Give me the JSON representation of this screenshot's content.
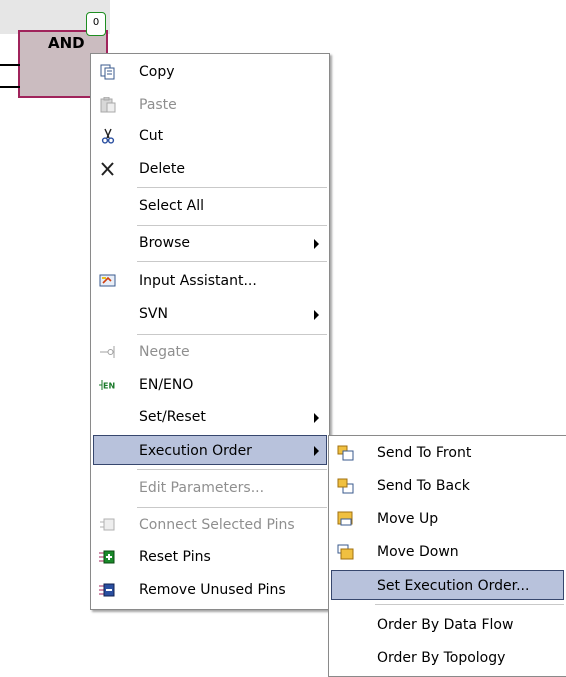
{
  "block": {
    "title": "AND",
    "order_badge": "0"
  },
  "context_menu": {
    "items": [
      {
        "label": "Copy",
        "enabled": true,
        "icon": "copy-icon"
      },
      {
        "label": "Paste",
        "enabled": false,
        "icon": "paste-icon"
      },
      {
        "label": "Cut",
        "enabled": true,
        "icon": "cut-icon"
      },
      {
        "label": "Delete",
        "enabled": true,
        "icon": "delete-icon"
      },
      {
        "label": "Select All",
        "enabled": true
      },
      {
        "label": "Browse",
        "enabled": true,
        "submenu": true
      },
      {
        "label": "Input Assistant...",
        "enabled": true,
        "icon": "input-assistant-icon"
      },
      {
        "label": "SVN",
        "enabled": true,
        "submenu": true
      },
      {
        "label": "Negate",
        "enabled": false,
        "icon": "negate-icon"
      },
      {
        "label": "EN/ENO",
        "enabled": true,
        "icon": "en-eno-icon"
      },
      {
        "label": "Set/Reset",
        "enabled": true,
        "submenu": true
      },
      {
        "label": "Execution Order",
        "enabled": true,
        "submenu": true,
        "highlighted": true
      },
      {
        "label": "Edit Parameters...",
        "enabled": false
      },
      {
        "label": "Connect Selected Pins",
        "enabled": false,
        "icon": "connect-pins-icon"
      },
      {
        "label": "Reset Pins",
        "enabled": true,
        "icon": "reset-pins-icon"
      },
      {
        "label": "Remove Unused Pins",
        "enabled": true,
        "icon": "remove-pins-icon"
      }
    ]
  },
  "execution_order_submenu": {
    "items": [
      {
        "label": "Send To Front",
        "icon": "send-to-front-icon"
      },
      {
        "label": "Send To Back",
        "icon": "send-to-back-icon"
      },
      {
        "label": "Move Up",
        "icon": "move-up-icon"
      },
      {
        "label": "Move Down",
        "icon": "move-down-icon"
      },
      {
        "label": "Set Execution Order...",
        "highlighted": true
      },
      {
        "label": "Order By Data Flow"
      },
      {
        "label": "Order By Topology"
      }
    ]
  },
  "colors": {
    "highlight_fill": "#b8c2dc",
    "highlight_border": "#37476e",
    "block_fill": "#cbbcc0",
    "block_border": "#a0235b",
    "disabled_text": "#8f8f8f"
  }
}
